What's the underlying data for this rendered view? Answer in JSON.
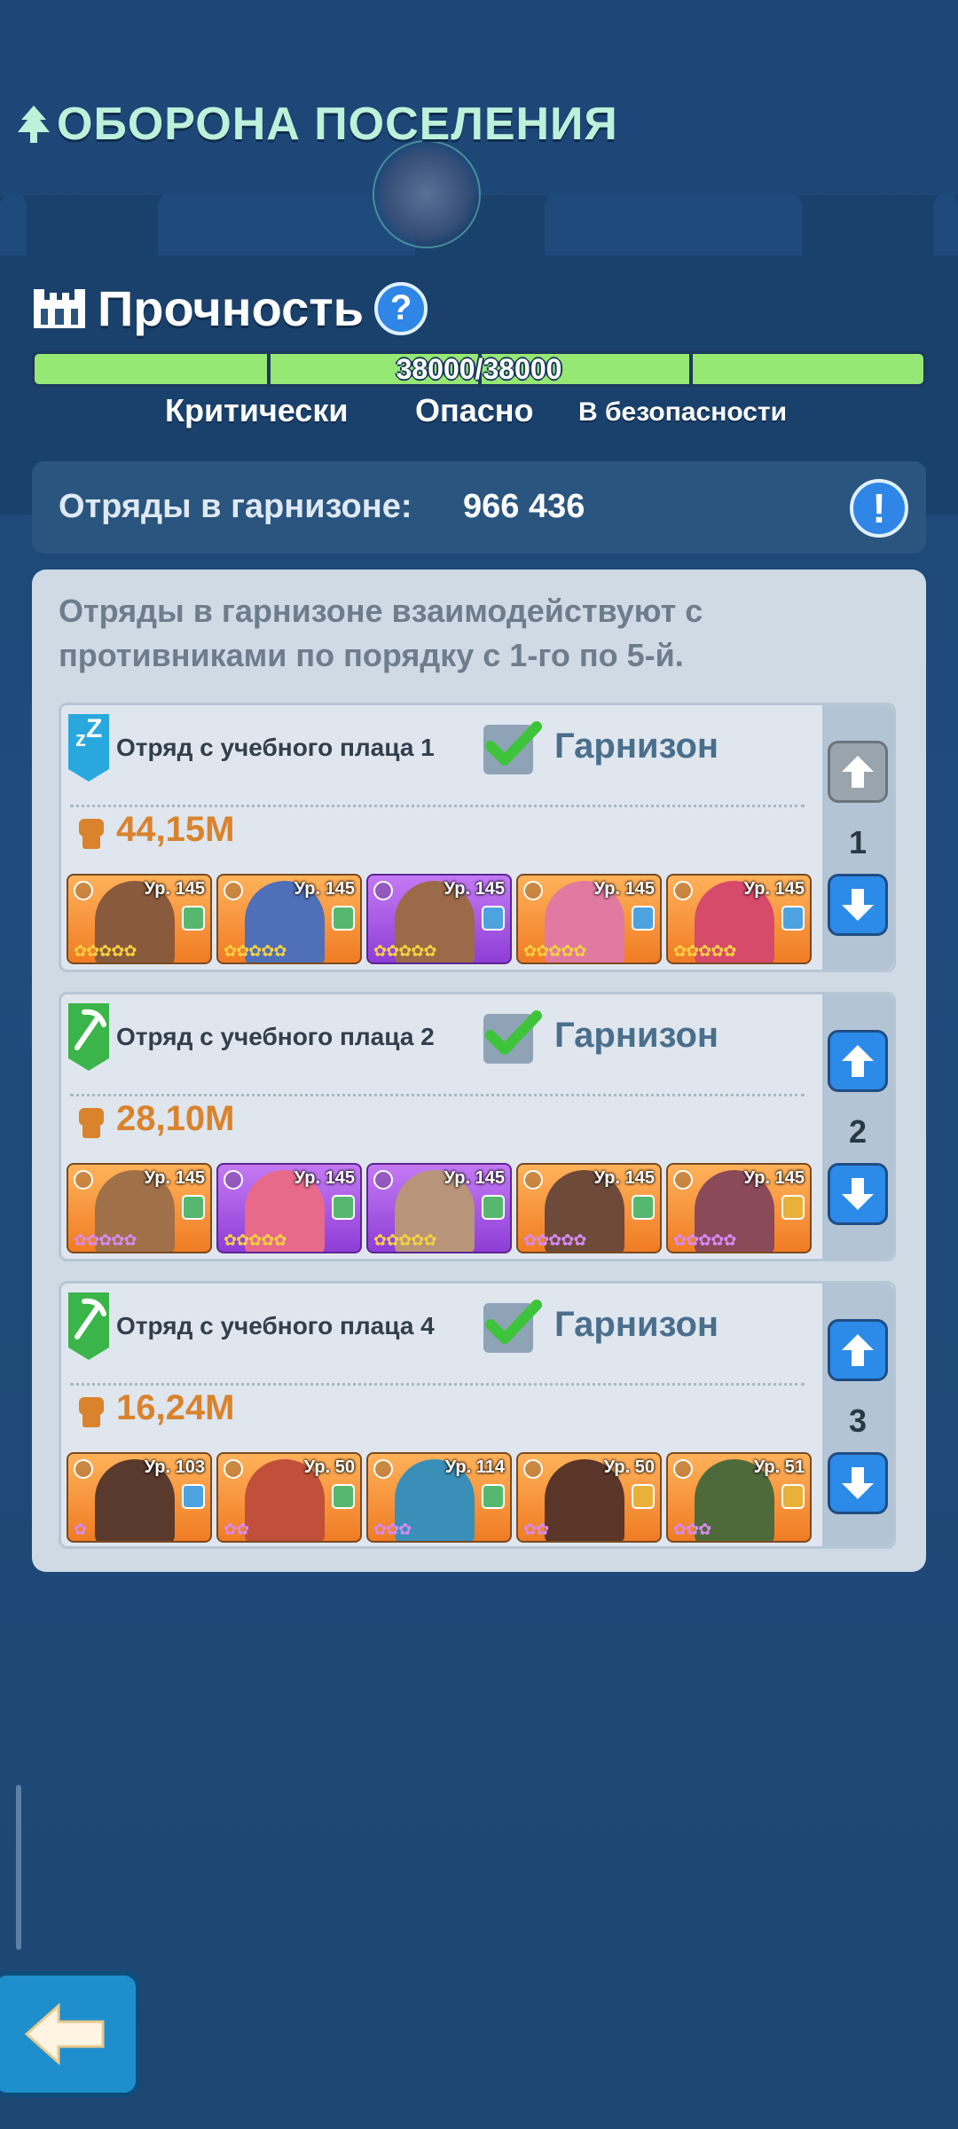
{
  "header": {
    "title": "ОБОРОНА ПОСЕЛЕНИЯ"
  },
  "durability": {
    "label": "Прочность",
    "help_icon": "question-icon",
    "help_symbol": "?",
    "value_text": "38000/38000",
    "fill_fraction": 1.0,
    "zones": [
      "Критически",
      "Опасно",
      "В безопасности"
    ],
    "bar_color": "#96e874"
  },
  "garrison": {
    "label": "Отряды в гарнизоне:",
    "value": "966 436",
    "info_icon": "exclamation-icon",
    "info_symbol": "!"
  },
  "panel": {
    "description": "Отряды в гарнизоне взаимодействуют с противниками по порядку с 1-го по 5-й."
  },
  "squads": [
    {
      "name": "Отряд с учебного плаца 1",
      "status": "Гарнизон",
      "power": "44,15M",
      "order": "1",
      "flag_icon": "sleep-icon",
      "flag_color": "#29a8e0",
      "up_enabled": false,
      "heroes": [
        {
          "level": "Ур. 145",
          "rarity": "orange"
        },
        {
          "level": "Ур. 145",
          "rarity": "orange"
        },
        {
          "level": "Ур. 145",
          "rarity": "purple"
        },
        {
          "level": "Ур. 145",
          "rarity": "orange"
        },
        {
          "level": "Ур. 145",
          "rarity": "orange"
        }
      ]
    },
    {
      "name": "Отряд с учебного плаца 2",
      "status": "Гарнизон",
      "power": "28,10M",
      "order": "2",
      "flag_icon": "pickaxe-icon",
      "flag_color": "#3bb54a",
      "up_enabled": true,
      "heroes": [
        {
          "level": "Ур. 145",
          "rarity": "orange"
        },
        {
          "level": "Ур. 145",
          "rarity": "purple"
        },
        {
          "level": "Ур. 145",
          "rarity": "purple"
        },
        {
          "level": "Ур. 145",
          "rarity": "orange"
        },
        {
          "level": "Ур. 145",
          "rarity": "orange"
        }
      ]
    },
    {
      "name": "Отряд с учебного плаца 4",
      "status": "Гарнизон",
      "power": "16,24M",
      "order": "3",
      "flag_icon": "pickaxe-icon",
      "flag_color": "#3bb54a",
      "up_enabled": true,
      "heroes": [
        {
          "level": "Ур. 103",
          "rarity": "orange"
        },
        {
          "level": "Ур. 50",
          "rarity": "orange"
        },
        {
          "level": "Ур. 114",
          "rarity": "orange"
        },
        {
          "level": "Ур. 50",
          "rarity": "orange"
        },
        {
          "level": "Ур. 51",
          "rarity": "orange"
        }
      ]
    }
  ],
  "footer": {
    "back_icon": "arrow-left-icon"
  }
}
